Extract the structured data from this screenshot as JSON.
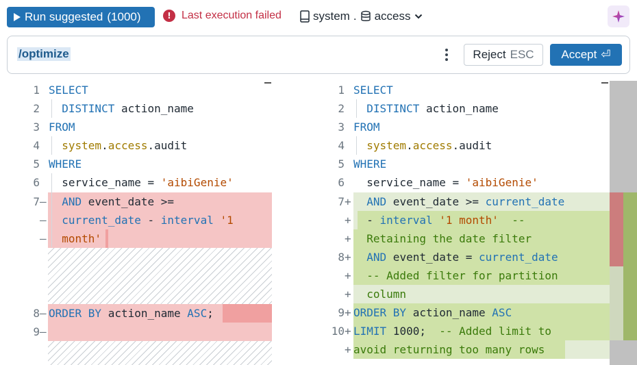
{
  "toolbar": {
    "run_label": "Run suggested",
    "run_count": "(1000)",
    "error_text": "Last execution failed",
    "catalog": "system",
    "separator": ".",
    "schema": "access"
  },
  "prompt": {
    "command": "/optimize",
    "reject_label": "Reject",
    "reject_shortcut": "ESC",
    "accept_label": "Accept",
    "accept_shortcut": "⏎"
  },
  "colors": {
    "primary": "#2272b4",
    "error": "#c32f45",
    "deleted_bg": "#f5c5c5",
    "added_bg": "#e3ecd6",
    "added_strong_bg": "#cfe2a8"
  },
  "left_lines": [
    {
      "n": "1",
      "tokens": [
        [
          "kw",
          "SELECT"
        ]
      ]
    },
    {
      "n": "2",
      "tokens": [
        [
          "kw",
          "  DISTINCT"
        ],
        [
          "",
          " action_name"
        ]
      ]
    },
    {
      "n": "3",
      "tokens": [
        [
          "kw",
          "FROM"
        ]
      ]
    },
    {
      "n": "4",
      "tokens": [
        [
          "obj",
          "  system"
        ],
        [
          "",
          "."
        ],
        [
          "obj",
          "access"
        ],
        [
          "",
          ".audit"
        ]
      ]
    },
    {
      "n": "5",
      "tokens": [
        [
          "kw",
          "WHERE"
        ]
      ]
    },
    {
      "n": "6",
      "tokens": [
        [
          "",
          "  service_name = "
        ],
        [
          "str",
          "'aibiGenie'"
        ]
      ]
    },
    {
      "n": "7",
      "tokens": [
        [
          "kw",
          "  AND"
        ],
        [
          "",
          " event_date >="
        ]
      ]
    },
    {
      "n": "",
      "tokens": [
        [
          "kw",
          "  current_date"
        ],
        [
          "",
          " - "
        ],
        [
          "kw",
          "interval"
        ],
        [
          "",
          " "
        ],
        [
          "str",
          "'1"
        ]
      ]
    },
    {
      "n": "",
      "tokens": [
        [
          "str",
          "  month'"
        ]
      ]
    },
    {
      "n": "8",
      "tokens": [
        [
          "kw",
          "ORDER BY"
        ],
        [
          "",
          " action_name "
        ],
        [
          "kw",
          "ASC"
        ],
        [
          "",
          ";"
        ]
      ]
    },
    {
      "n": "9",
      "tokens": [
        [
          "",
          ""
        ]
      ]
    }
  ],
  "right_lines": [
    {
      "n": "1",
      "tokens": [
        [
          "kw",
          "SELECT"
        ]
      ]
    },
    {
      "n": "2",
      "tokens": [
        [
          "kw",
          "  DISTINCT"
        ],
        [
          "",
          " action_name"
        ]
      ]
    },
    {
      "n": "3",
      "tokens": [
        [
          "kw",
          "FROM"
        ]
      ]
    },
    {
      "n": "4",
      "tokens": [
        [
          "obj",
          "  system"
        ],
        [
          "",
          "."
        ],
        [
          "obj",
          "access"
        ],
        [
          "",
          ".audit"
        ]
      ]
    },
    {
      "n": "5",
      "tokens": [
        [
          "kw",
          "WHERE"
        ]
      ]
    },
    {
      "n": "6",
      "tokens": [
        [
          "",
          "  service_name = "
        ],
        [
          "str",
          "'aibiGenie'"
        ]
      ]
    },
    {
      "n": "7",
      "tokens": [
        [
          "kw",
          "  AND"
        ],
        [
          "",
          " event_date >= "
        ],
        [
          "kw",
          "current_date"
        ]
      ]
    },
    {
      "n": "",
      "tokens": [
        [
          "",
          "  - "
        ],
        [
          "kw",
          "interval"
        ],
        [
          "",
          " "
        ],
        [
          "str",
          "'1 month'"
        ],
        [
          "cm",
          "  --"
        ]
      ]
    },
    {
      "n": "",
      "tokens": [
        [
          "cm",
          "  Retaining the date filter"
        ]
      ]
    },
    {
      "n": "8",
      "tokens": [
        [
          "kw",
          "  AND"
        ],
        [
          "",
          " event_date = "
        ],
        [
          "kw",
          "current_date"
        ]
      ]
    },
    {
      "n": "",
      "tokens": [
        [
          "cm",
          "  -- Added filter for partition"
        ]
      ]
    },
    {
      "n": "",
      "tokens": [
        [
          "cm",
          "  column"
        ]
      ]
    },
    {
      "n": "9",
      "tokens": [
        [
          "kw",
          "ORDER BY"
        ],
        [
          "",
          " action_name "
        ],
        [
          "kw",
          "ASC"
        ]
      ]
    },
    {
      "n": "10",
      "tokens": [
        [
          "kw",
          "LIMIT"
        ],
        [
          "",
          " 1000;  "
        ],
        [
          "cm",
          "-- Added limit to"
        ]
      ]
    },
    {
      "n": "",
      "tokens": [
        [
          "cm",
          "avoid returning too many rows"
        ]
      ]
    }
  ]
}
